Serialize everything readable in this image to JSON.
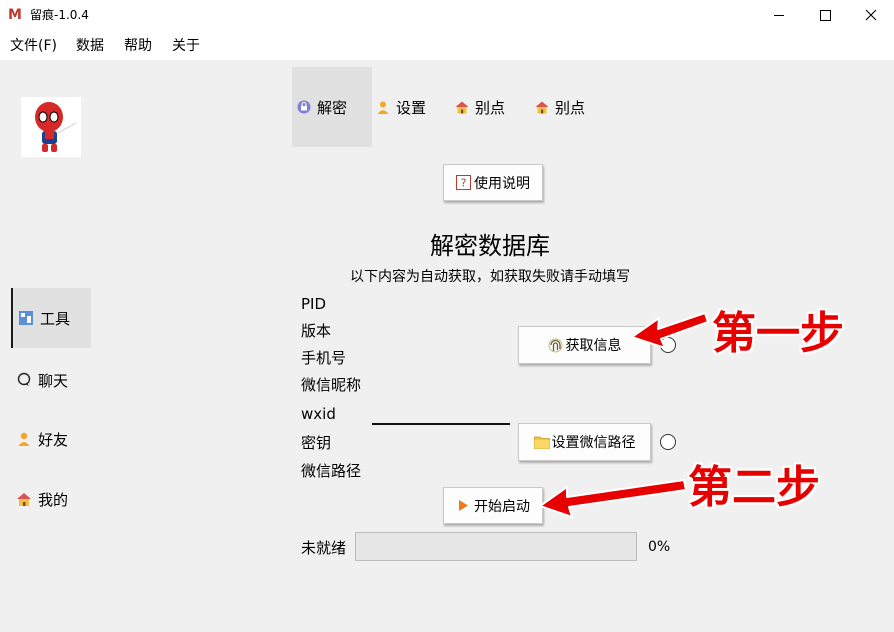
{
  "window": {
    "title": "留痕-1.0.4",
    "app_icon": "M"
  },
  "menu": [
    "文件(F)",
    "数据",
    "帮助",
    "关于"
  ],
  "sidebar": {
    "items": [
      {
        "label": "工具",
        "icon": "tools-icon",
        "active": true
      },
      {
        "label": "聊天",
        "icon": "chat-icon"
      },
      {
        "label": "好友",
        "icon": "person-icon"
      },
      {
        "label": "我的",
        "icon": "home-icon"
      }
    ]
  },
  "tabs": [
    {
      "label": "解密",
      "icon": "lock-icon",
      "active": true
    },
    {
      "label": "设置",
      "icon": "person-icon"
    },
    {
      "label": "别点",
      "icon": "house-icon"
    },
    {
      "label": "别点",
      "icon": "house-icon"
    }
  ],
  "help_button": {
    "label": "使用说明",
    "icon": "question-icon"
  },
  "main": {
    "title": "解密数据库",
    "subtitle": "以下内容为自动获取，如获取失败请手动填写",
    "fields": [
      "PID",
      "版本",
      "手机号",
      "微信昵称",
      "wxid",
      "密钥",
      "微信路径"
    ]
  },
  "buttons": {
    "get_info": "获取信息",
    "set_path": "设置微信路径",
    "start": "开始启动"
  },
  "status": {
    "label": "未就绪",
    "progress": 0,
    "percent_text": "0%"
  },
  "annotations": {
    "step1": "第一步",
    "step2": "第二步"
  },
  "colors": {
    "annotation_red": "#e60000",
    "background": "#f0f0f0"
  }
}
